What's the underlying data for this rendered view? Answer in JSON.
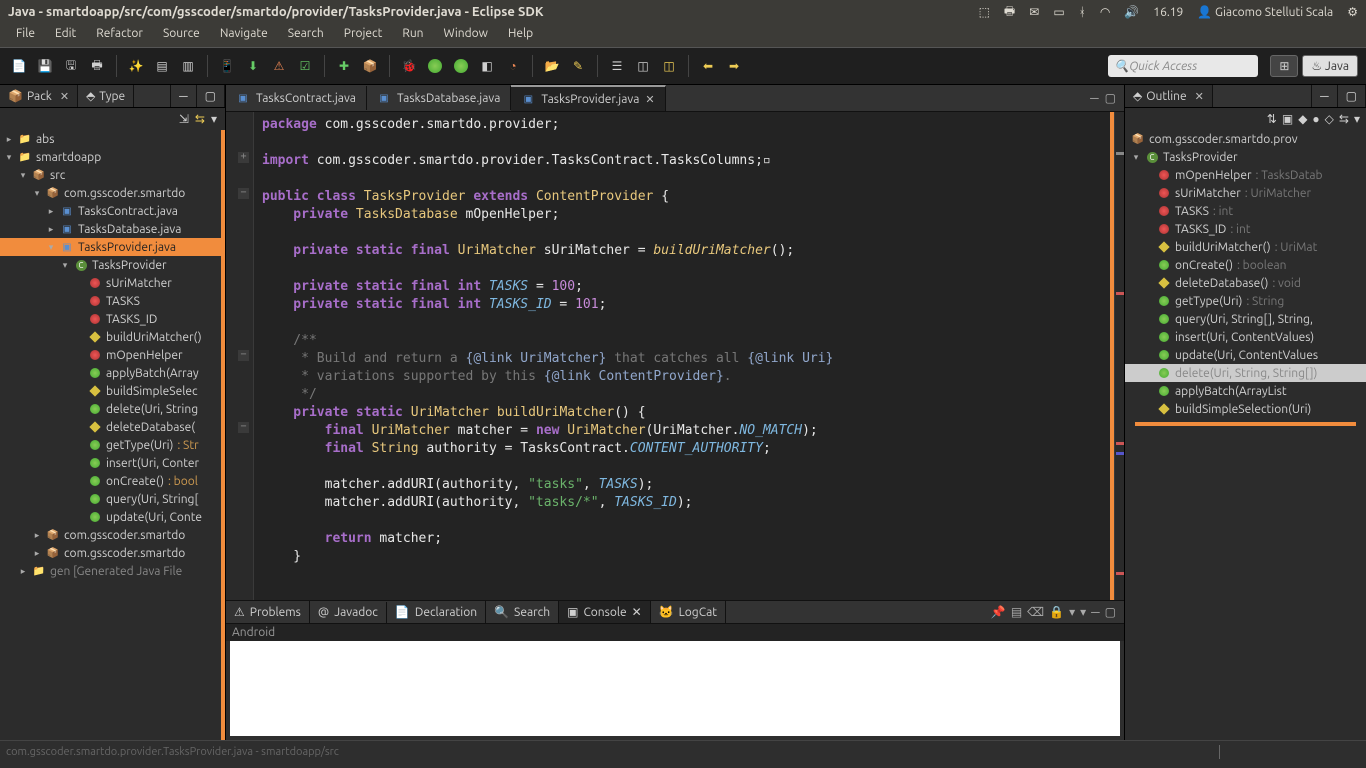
{
  "sysbar": {
    "title": "Java - smartdoapp/src/com/gsscoder/smartdo/provider/TasksProvider.java - Eclipse SDK",
    "time": "16.19",
    "user": "Giacomo Stelluti Scala"
  },
  "menu": [
    "File",
    "Edit",
    "Refactor",
    "Source",
    "Navigate",
    "Search",
    "Project",
    "Run",
    "Window",
    "Help"
  ],
  "quickaccess": {
    "placeholder": "Quick Access"
  },
  "perspectives": {
    "java": "Java"
  },
  "left_tabs": {
    "pack": "Pack",
    "type": "Type"
  },
  "tree": {
    "items": [
      {
        "d": 0,
        "caret": "closed",
        "icon": "📁",
        "label": "abs"
      },
      {
        "d": 0,
        "caret": "open",
        "icon": "📁",
        "label": "smartdoapp"
      },
      {
        "d": 1,
        "caret": "open",
        "icon": "📦",
        "label": "src"
      },
      {
        "d": 2,
        "caret": "open",
        "icon": "📦",
        "label": "com.gsscoder.smartdo"
      },
      {
        "d": 3,
        "caret": "closed",
        "icon": "J",
        "label": "TasksContract.java"
      },
      {
        "d": 3,
        "caret": "closed",
        "icon": "J",
        "label": "TasksDatabase.java"
      },
      {
        "d": 3,
        "caret": "open",
        "icon": "J",
        "label": "TasksProvider.java",
        "selected": true
      },
      {
        "d": 4,
        "caret": "open",
        "icon": "C",
        "label": "TasksProvider"
      },
      {
        "d": 5,
        "caret": "none",
        "icon": "●r",
        "label": "sUriMatcher"
      },
      {
        "d": 5,
        "caret": "none",
        "icon": "●r",
        "label": "TASKS"
      },
      {
        "d": 5,
        "caret": "none",
        "icon": "●r",
        "label": "TASKS_ID"
      },
      {
        "d": 5,
        "caret": "none",
        "icon": "◆",
        "label": "buildUriMatcher()"
      },
      {
        "d": 5,
        "caret": "none",
        "icon": "●r",
        "label": "mOpenHelper"
      },
      {
        "d": 5,
        "caret": "none",
        "icon": "●g",
        "label": "applyBatch(Array"
      },
      {
        "d": 5,
        "caret": "none",
        "icon": "◆",
        "label": "buildSimpleSelec"
      },
      {
        "d": 5,
        "caret": "none",
        "icon": "●g",
        "label": "delete(Uri, String"
      },
      {
        "d": 5,
        "caret": "none",
        "icon": "◆",
        "label": "deleteDatabase("
      },
      {
        "d": 5,
        "caret": "none",
        "icon": "●g",
        "label": "getType(Uri)",
        "sig": " : Str"
      },
      {
        "d": 5,
        "caret": "none",
        "icon": "●g",
        "label": "insert(Uri, Conter"
      },
      {
        "d": 5,
        "caret": "none",
        "icon": "●g",
        "label": "onCreate()",
        "sig": " : bool"
      },
      {
        "d": 5,
        "caret": "none",
        "icon": "●g",
        "label": "query(Uri, String["
      },
      {
        "d": 5,
        "caret": "none",
        "icon": "●g",
        "label": "update(Uri, Conte"
      },
      {
        "d": 2,
        "caret": "closed",
        "icon": "📦",
        "label": "com.gsscoder.smartdo"
      },
      {
        "d": 2,
        "caret": "closed",
        "icon": "📦",
        "label": "com.gsscoder.smartdo"
      },
      {
        "d": 1,
        "caret": "closed",
        "icon": "📁",
        "label": "gen [Generated Java File",
        "dim": true
      }
    ]
  },
  "editor_tabs": [
    {
      "icon": "J",
      "label": "TasksContract.java"
    },
    {
      "icon": "J",
      "label": "TasksDatabase.java"
    },
    {
      "icon": "J",
      "label": "TasksProvider.java",
      "active": true
    }
  ],
  "code": {
    "l1_pkg": "package",
    "l1_rest": " com.gsscoder.smartdo.provider;",
    "l3_imp": "import",
    "l3_rest": " com.gsscoder.smartdo.provider.TasksContract.TasksColumns;",
    "l5_public": "public",
    "l5_class": " class ",
    "l5_name": "TasksProvider",
    "l5_ext": " extends ",
    "l5_sup": "ContentProvider",
    "l5_brace": " {",
    "l6_priv": "    private ",
    "l6_type": "TasksDatabase",
    "l6_var": " mOpenHelper;",
    "l8_a": "    private static final ",
    "l8_type": "UriMatcher",
    "l8_var": " sUriMatcher = ",
    "l8_call": "buildUriMatcher",
    "l8_end": "();",
    "l10_a": "    private static final int ",
    "l10_var": "TASKS",
    "l10_eq": " = ",
    "l10_num": "100",
    "l10_end": ";",
    "l11_a": "    private static final int ",
    "l11_var": "TASKS_ID",
    "l11_eq": " = ",
    "l11_num": "101",
    "l11_end": ";",
    "c1": "    /**",
    "c2a": "     * Build and return a ",
    "c2b": "{@link UriMatcher}",
    "c2c": " that catches all ",
    "c2d": "{@link Uri}",
    "c3a": "     * variations supported by this ",
    "c3b": "{@link ContentProvider}",
    "c3c": ".",
    "c4": "     */",
    "l17_a": "    private static ",
    "l17_type": "UriMatcher",
    "l17_name": " buildUriMatcher",
    "l17_end": "() {",
    "l18_a": "        final ",
    "l18_type": "UriMatcher",
    "l18_var": " matcher = ",
    "l18_new": "new ",
    "l18_ctor": "UriMatcher",
    "l18_p": "(UriMatcher.",
    "l18_const": "NO_MATCH",
    "l18_end": ");",
    "l19_a": "        final ",
    "l19_type": "String",
    "l19_var": " authority = TasksContract.",
    "l19_const": "CONTENT_AUTHORITY",
    "l19_end": ";",
    "l21": "        matcher.addURI(authority, ",
    "l21_s": "\"tasks\"",
    "l21_m": ", ",
    "l21_c": "TASKS",
    "l21_e": ");",
    "l22": "        matcher.addURI(authority, ",
    "l22_s": "\"tasks/*\"",
    "l22_m": ", ",
    "l22_c": "TASKS_ID",
    "l22_e": ");",
    "l24_a": "        return",
    "l24_b": " matcher;",
    "l25": "    }"
  },
  "outline_tab": "Outline",
  "outline": {
    "pkg": "com.gsscoder.smartdo.prov",
    "cls": "TasksProvider",
    "items": [
      {
        "icon": "●r",
        "label": "mOpenHelper",
        "type": " : TasksDatab"
      },
      {
        "icon": "●r",
        "label": "sUriMatcher",
        "type": " : UriMatcher"
      },
      {
        "icon": "●r",
        "label": "TASKS",
        "type": " : int"
      },
      {
        "icon": "●r",
        "label": "TASKS_ID",
        "type": " : int"
      },
      {
        "icon": "◆",
        "label": "buildUriMatcher()",
        "type": " : UriMat"
      },
      {
        "icon": "●g",
        "label": "onCreate()",
        "type": " : boolean"
      },
      {
        "icon": "◆",
        "label": "deleteDatabase()",
        "type": " : void"
      },
      {
        "icon": "●g",
        "label": "getType(Uri)",
        "type": " : String"
      },
      {
        "icon": "●g",
        "label": "query(Uri, String[], String, "
      },
      {
        "icon": "●g",
        "label": "insert(Uri, ContentValues)"
      },
      {
        "icon": "●g",
        "label": "update(Uri, ContentValues"
      },
      {
        "icon": "●g",
        "label": "delete(Uri, String, String[])",
        "selected": true
      },
      {
        "icon": "●g",
        "label": "applyBatch(ArrayList<Con"
      },
      {
        "icon": "◆",
        "label": "buildSimpleSelection(Uri)"
      }
    ]
  },
  "bottom_tabs": [
    {
      "icon": "⚠",
      "label": "Problems"
    },
    {
      "icon": "@",
      "label": "Javadoc"
    },
    {
      "icon": "📄",
      "label": "Declaration"
    },
    {
      "icon": "🔍",
      "label": "Search"
    },
    {
      "icon": "▣",
      "label": "Console",
      "active": true
    },
    {
      "icon": "🐱",
      "label": "LogCat"
    }
  ],
  "console_label": "Android",
  "status": "com.gsscoder.smartdo.provider.TasksProvider.java - smartdoapp/src"
}
